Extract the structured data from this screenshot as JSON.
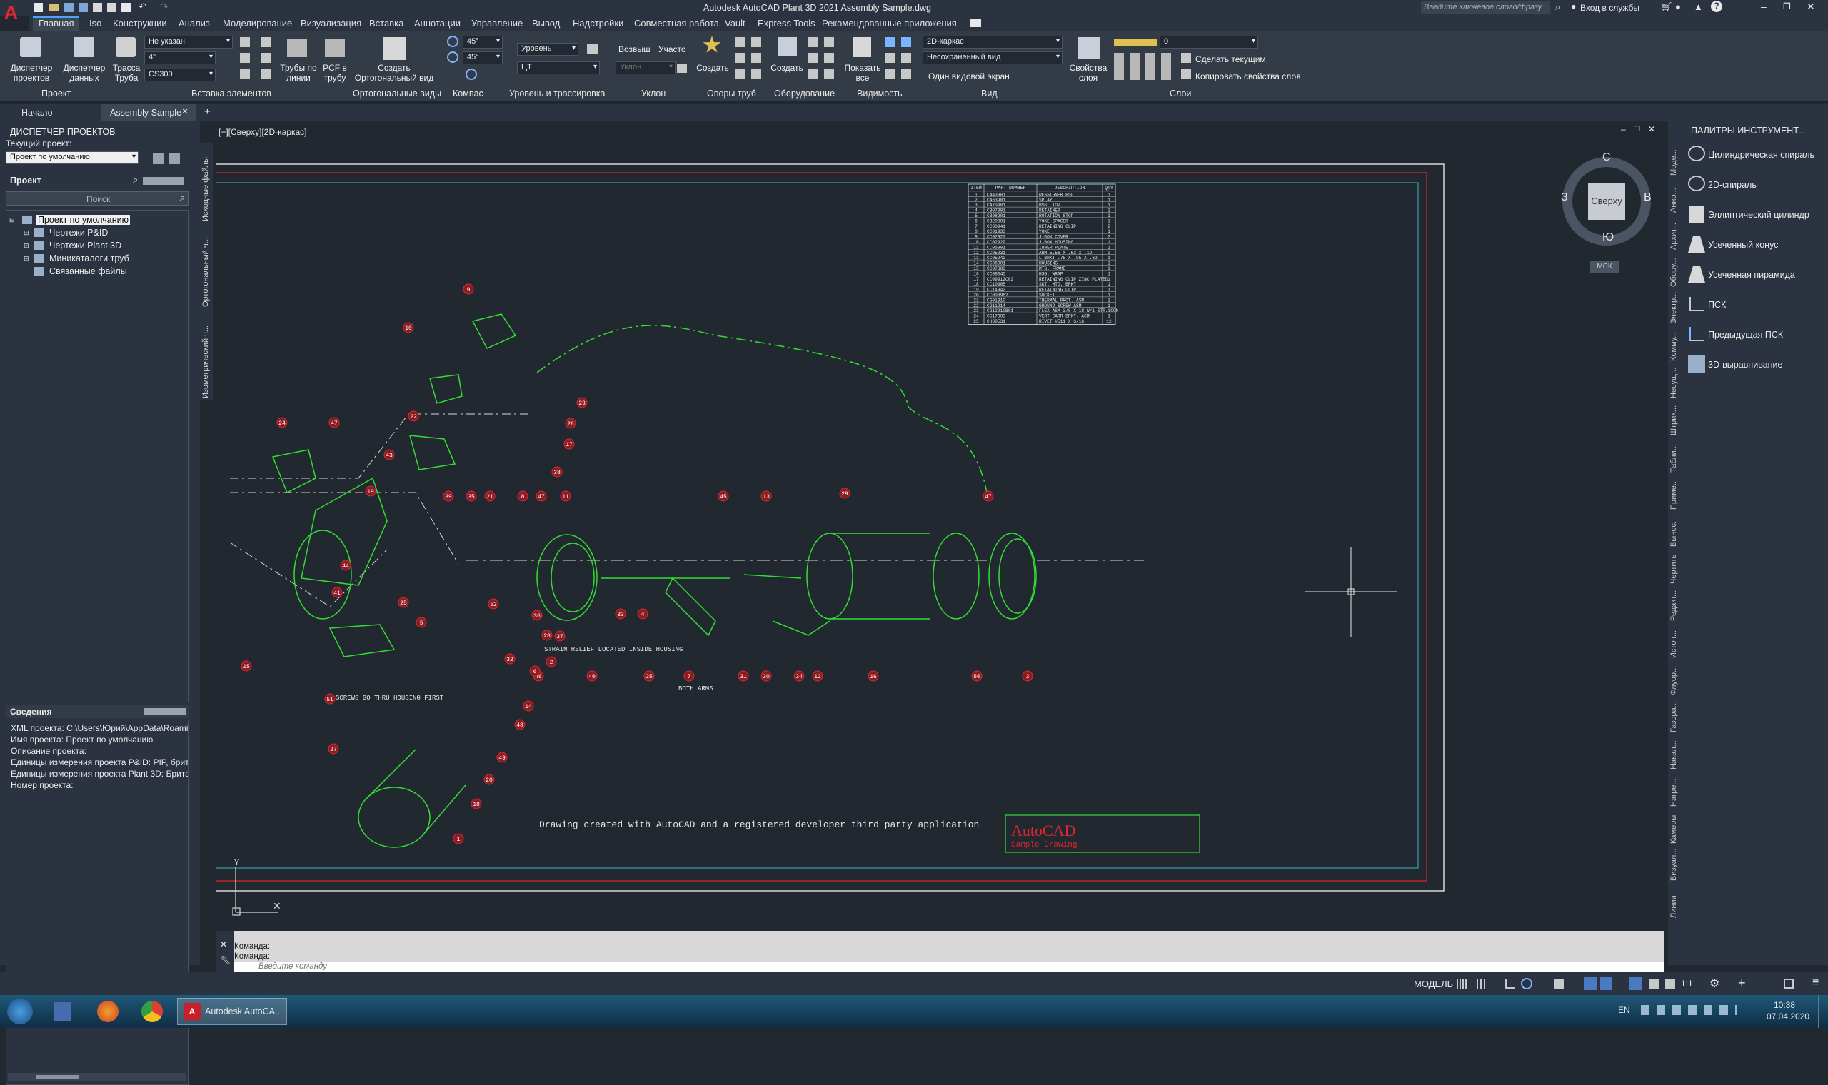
{
  "app": {
    "title": "Autodesk AutoCAD Plant 3D 2021  Assembly Sample.dwg",
    "search_placeholder": "Введите ключевое слово/фразу",
    "signin": "Вход в службы"
  },
  "ribbon_tabs": [
    "Главная",
    "Iso",
    "Конструкции",
    "Анализ",
    "Моделирование",
    "Визуализация",
    "Вставка",
    "Аннотации",
    "Управление",
    "Вывод",
    "Надстройки",
    "Совместная работа",
    "Vault",
    "Express Tools",
    "Рекомендованные приложения"
  ],
  "ribbon": {
    "project_mgr": "Диспетчер проектов",
    "data_mgr": "Диспетчер данных",
    "route_pipe": "Трасса Труба",
    "spec_combo": "Не указан",
    "size_combo": "4\"",
    "cs_combo": "CS300",
    "pipes_by_lines": "Трубы по линии",
    "pcf_to_pipe": "PCF в трубу",
    "create_ortho": "Создать Ортогональный вид",
    "angle1": "45°",
    "angle2": "45°",
    "level_combo": "Уровень",
    "ct_combo": "ЦТ",
    "rise": "Возвыш",
    "segment": "Участо",
    "slope_combo": "Уклон",
    "create1": "Создать",
    "create2": "Создать",
    "show_all": "Показать все",
    "visual_style": "2D-каркас",
    "saved_view": "Несохраненный вид",
    "single_viewport": "Один видовой экран",
    "layer_props": "Свойства слоя",
    "layer_combo": "0",
    "make_current": "Сделать текущим",
    "copy_layer": "Копировать свойства слоя",
    "panels": {
      "project": "Проект",
      "insert": "Вставка элементов",
      "ortho": "Ортогональные виды",
      "compass": "Компас",
      "level": "Уровень и трассировка",
      "slope": "Уклон",
      "supports": "Опоры труб",
      "equipment": "Оборудование",
      "visibility": "Видимость",
      "view": "Вид",
      "layers": "Слои"
    }
  },
  "doc_tabs": {
    "start": "Начало",
    "active": "Assembly Sample"
  },
  "project_manager": {
    "title": "ДИСПЕТЧЕР ПРОЕКТОВ",
    "current_label": "Текущий проект:",
    "current_value": "Проект по умолчанию",
    "project_label": "Проект",
    "search_placeholder": "Поиск",
    "tree": [
      "Проект по умолчанию",
      "Чертежи P&ID",
      "Чертежи Plant 3D",
      "Миникаталоги труб",
      "Связанные файлы"
    ],
    "vtabs": [
      "Исходные файлы",
      "Ортогональный ч...",
      "Изометрический ч..."
    ],
    "details_title": "Сведения",
    "details": [
      "XML проекта: C:\\Users\\Юрий\\AppData\\Roami",
      "Имя проекта: Проект по умолчанию",
      "Описание проекта:",
      "Единицы измерения проекта P&ID: PIP, брит",
      "Единицы измерения проекта Plant 3D: Брита",
      "Номер проекта:"
    ]
  },
  "viewport": {
    "label": "[−][Сверху][2D-каркас]",
    "viewcube_top": "Сверху",
    "north": "С",
    "south": "Ю",
    "west": "З",
    "east": "В",
    "ucs": "МСК"
  },
  "bom": {
    "headers": [
      "ITEM",
      "PART NUMBER",
      "DESCRIPTION",
      "QTY"
    ],
    "rows": [
      [
        "1",
        "CA43901",
        "DESSIGNER HSG",
        "1"
      ],
      [
        "2",
        "CA63901",
        "SPLAY",
        "1"
      ],
      [
        "3",
        "CA70901",
        "HSG. TOP",
        "1"
      ],
      [
        "4",
        "CB07901",
        "RETAINER",
        "1"
      ],
      [
        "5",
        "CB08901",
        "ROTATION STOP",
        "1"
      ],
      [
        "6",
        "CB20901",
        "YOKE SPACER",
        "1"
      ],
      [
        "7",
        "CC00941",
        "RETAINING CLIP",
        "2"
      ],
      [
        "8",
        "CC01933",
        "YOKE",
        "1"
      ],
      [
        "9",
        "CC02927",
        "J-BOX COVER",
        "2"
      ],
      [
        "10",
        "CC02929",
        "J-BOX HOUSING",
        "1"
      ],
      [
        "11",
        "CC05901",
        "INNER PLATE",
        "1"
      ],
      [
        "12",
        "CC05931",
        "ARM 5.56 X .62 X .19",
        "2"
      ],
      [
        "13",
        "CC05942",
        "L-BRKT .75 X .95 X .62",
        "1"
      ],
      [
        "14",
        "CC06901",
        "HOUSING",
        "1"
      ],
      [
        "15",
        "CC07303",
        "MTG. FRAME",
        "1"
      ],
      [
        "16",
        "CC08045",
        "HSG. WRAP",
        "1"
      ],
      [
        "17",
        "CC09912C02",
        "RETAINING CLIP ZINC PLATED",
        "1"
      ],
      [
        "18",
        "CC10905",
        "SKT. MTG. BRKT",
        "1"
      ],
      [
        "19",
        "CC14942",
        "RETAINING CLIP",
        "1"
      ],
      [
        "20",
        "CC003962",
        "SOCKET",
        "1"
      ],
      [
        "21",
        "CG01910",
        "THERMAL PROT. ASM.",
        "1"
      ],
      [
        "22",
        "CG11914",
        "GROUND SCREW ASM",
        "1"
      ],
      [
        "23",
        "CG12910B01",
        "FLEX ASM 3/8 X 18 W/1 STR. CON",
        "1"
      ],
      [
        "24",
        "CG17903",
        "VERT CARR BRKT. ASM",
        "1"
      ],
      [
        "25",
        "CH88531",
        "RIVET #511 X 3/16",
        "12"
      ]
    ]
  },
  "drawing": {
    "note": "Drawing created with AutoCAD and a registered developer third party application",
    "logo": "AutoCAD",
    "logo_sub": "Sample Drawing",
    "screws_note": "SCREWS GO THRU HOUSING FIRST",
    "strain_note": "STRAIN RELIEF LOCATED INSIDE HOUSING",
    "both_arms": "BOTH ARMS",
    "balloons": [
      "9",
      "10",
      "22",
      "23",
      "26",
      "17",
      "24",
      "47",
      "43",
      "38",
      "19",
      "39",
      "35",
      "21",
      "8",
      "47",
      "11",
      "45",
      "13",
      "29",
      "47",
      "44",
      "41",
      "25",
      "5",
      "52",
      "36",
      "28",
      "37",
      "33",
      "4",
      "46",
      "32",
      "40",
      "25",
      "7",
      "31",
      "30",
      "34",
      "12",
      "16",
      "50",
      "3",
      "15",
      "51",
      "14",
      "48",
      "49",
      "27",
      "20",
      "18",
      "1",
      "6",
      "2"
    ]
  },
  "tool_palette": {
    "title": "ПАЛИТРЫ ИНСТРУМЕНТ...",
    "items": [
      "Цилиндрическая спираль",
      "2D-спираль",
      "Эллиптический цилиндр",
      "Усеченный конус",
      "Усеченная пирамида",
      "ПСК",
      "Предыдущая ПСК",
      "3D-выравнивание"
    ],
    "vtabs": [
      "Моде...",
      "Анно...",
      "Архит...",
      "Обору...",
      "Электр...",
      "Комму...",
      "Несущ...",
      "Штрих...",
      "Табли...",
      "Приме...",
      "Вынос...",
      "Чертить",
      "Редакт...",
      "Источ...",
      "Флуор...",
      "Газора...",
      "Накал...",
      "Нагре...",
      "Камеры",
      "Визуал...",
      "Линии"
    ]
  },
  "command": {
    "line1": "Команда:",
    "line2": "Команда:",
    "placeholder": "Введите команду"
  },
  "status": {
    "model": "МОДЕЛЬ",
    "scale": "1:1"
  },
  "taskbar": {
    "active_app": "Autodesk AutoCA...",
    "lang": "EN",
    "time": "10:38",
    "date": "07.04.2020"
  }
}
